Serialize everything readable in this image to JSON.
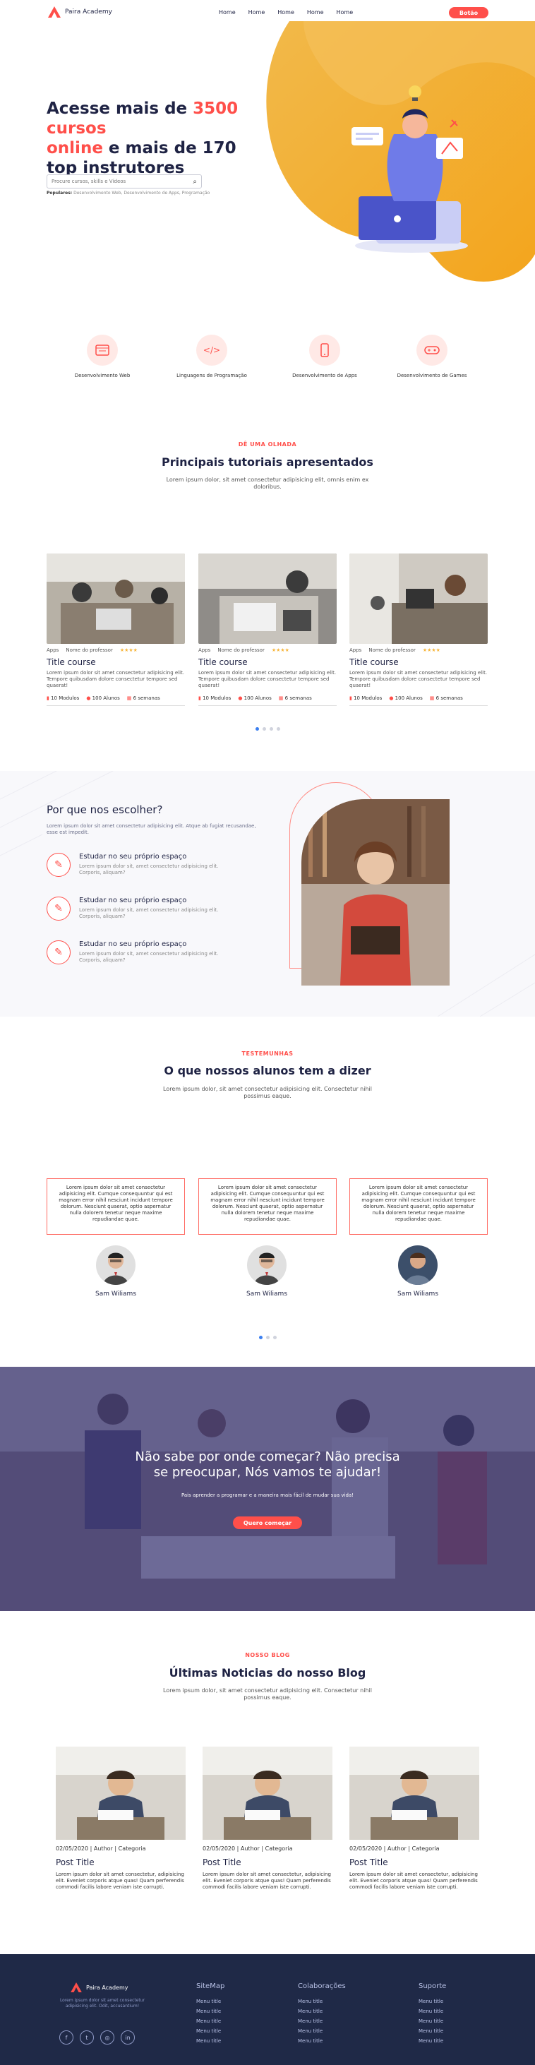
{
  "header": {
    "brand": "Paira Academy",
    "nav": [
      "Home",
      "Home",
      "Home",
      "Home",
      "Home"
    ],
    "cta": "Botão"
  },
  "hero": {
    "title_a": "Acesse mais de ",
    "title_b": "3500 cursos",
    "title_c": "online",
    "title_d": " e mais de 170",
    "title_e": "top instrutores",
    "search_placeholder": "Procure cursos, skills e Vídeos",
    "popular_label": "Populares:",
    "popular_items": "Desenvolvimento Web, Desenvolvimento de Apps, Programação"
  },
  "categories": [
    {
      "label": "Desenvolvimento Web",
      "icon": "web-icon"
    },
    {
      "label": "Linguagens de Programação",
      "icon": "code-icon"
    },
    {
      "label": "Desenvolvimento de Apps",
      "icon": "mobile-icon"
    },
    {
      "label": "Desenvolvimento de Games",
      "icon": "gamepad-icon"
    }
  ],
  "tutorials": {
    "kicker": "DÊ UMA OLHADA",
    "title": "Principais tutoriais apresentados",
    "subtitle": "Lorem ipsum dolor, sit amet consectetur adipisicing elit, omnis enim ex doloribus.",
    "cards": [
      {
        "cat": "Apps",
        "teacher": "Nome do professor",
        "stars": "★★★★",
        "title": "Title course",
        "text": "Lorem ipsum dolor sit amet consectetur adipisicing elit. Tempore quibusdam dolore consectetur tempore sed quaerat!",
        "modules": "10 Modulos",
        "students": "100 Alunos",
        "weeks": "6 semanas"
      },
      {
        "cat": "Apps",
        "teacher": "Nome do professor",
        "stars": "★★★★",
        "title": "Title course",
        "text": "Lorem ipsum dolor sit amet consectetur adipisicing elit. Tempore quibusdam dolore consectetur tempore sed quaerat!",
        "modules": "10 Modulos",
        "students": "100 Alunos",
        "weeks": "6 semanas"
      },
      {
        "cat": "Apps",
        "teacher": "Nome do professor",
        "stars": "★★★★",
        "title": "Title course",
        "text": "Lorem ipsum dolor sit amet consectetur adipisicing elit. Tempore quibusdam dolore consectetur tempore sed quaerat!",
        "modules": "10 Modulos",
        "students": "100 Alunos",
        "weeks": "6 semanas"
      }
    ]
  },
  "why": {
    "title": "Por que nos escolher?",
    "subtitle": "Lorem ipsum dolor sit amet consectetur adipisicing elit. Atque ab fugiat recusandae, esse est impedit.",
    "items": [
      {
        "title": "Estudar no seu próprio espaço",
        "text": "Lorem ipsum dolor sit, amet consectetur adipisicing elit. Corporis, aliquam?"
      },
      {
        "title": "Estudar no seu próprio espaço",
        "text": "Lorem ipsum dolor sit, amet consectetur adipisicing elit. Corporis, aliquam?"
      },
      {
        "title": "Estudar no seu próprio espaço",
        "text": "Lorem ipsum dolor sit, amet consectetur adipisicing elit. Corporis, aliquam?"
      }
    ]
  },
  "testimonials": {
    "kicker": "TESTEMUNHAS",
    "title": "O que nossos alunos tem a dizer",
    "subtitle": "Lorem ipsum dolor, sit amet consectetur adipisicing elit. Consectetur nihil possimus eaque.",
    "items": [
      {
        "text": "Lorem ipsum dolor sit amet consectetur adipisicing elit. Cumque consequuntur qui est magnam error nihil nesciunt incidunt tempore dolorum. Nesciunt quaerat, optio aspernatur nulla dolorem tenetur neque maxime repudiandae quae.",
        "name": "Sam Wiliams"
      },
      {
        "text": "Lorem ipsum dolor sit amet consectetur adipisicing elit. Cumque consequuntur qui est magnam error nihil nesciunt incidunt tempore dolorum. Nesciunt quaerat, optio aspernatur nulla dolorem tenetur neque maxime repudiandae quae.",
        "name": "Sam Wiliams"
      },
      {
        "text": "Lorem ipsum dolor sit amet consectetur adipisicing elit. Cumque consequuntur qui est magnam error nihil nesciunt incidunt tempore dolorum. Nesciunt quaerat, optio aspernatur nulla dolorem tenetur neque maxime repudiandae quae.",
        "name": "Sam Wiliams"
      }
    ]
  },
  "banner": {
    "title_1": "Não sabe por onde começar? Não precisa",
    "title_2": "se preocupar, Nós vamos te ajudar!",
    "subtitle": "Pais aprender a programar e a maneira mais fácil de mudar sua vida!",
    "cta": "Quero começar"
  },
  "blog": {
    "kicker": "NOSSO BLOG",
    "title": "Últimas Noticias do nosso Blog",
    "subtitle": "Lorem ipsum dolor, sit amet consectetur adipisicing elit. Consectetur nihil possimus eaque.",
    "posts": [
      {
        "date": "02/05/2020 | Author | Categoria",
        "title": "Post Title",
        "text": "Lorem ipsum dolor sit amet consectetur, adipisicing elit. Eveniet corporis atque quas! Quam perferendis commodi facilis labore veniam iste corrupti."
      },
      {
        "date": "02/05/2020 | Author | Categoria",
        "title": "Post Title",
        "text": "Lorem ipsum dolor sit amet consectetur, adipisicing elit. Eveniet corporis atque quas! Quam perferendis commodi facilis labore veniam iste corrupti."
      },
      {
        "date": "02/05/2020 | Author | Categoria",
        "title": "Post Title",
        "text": "Lorem ipsum dolor sit amet consectetur, adipisicing elit. Eveniet corporis atque quas! Quam perferendis commodi facilis labore veniam iste corrupti."
      }
    ]
  },
  "footer": {
    "brand": "Paira Academy",
    "about": "Lorem ipsum dolor sit amet consectetur adipisicing elit. Odit, accusantium!",
    "socials": [
      "f",
      "t",
      "◎",
      "in"
    ],
    "columns": [
      {
        "title": "SiteMap",
        "items": [
          "Menu title",
          "Menu title",
          "Menu title",
          "Menu title",
          "Menu title"
        ]
      },
      {
        "title": "Colaborações",
        "items": [
          "Menu title",
          "Menu title",
          "Menu title",
          "Menu title",
          "Menu title"
        ]
      },
      {
        "title": "Suporte",
        "items": [
          "Menu title",
          "Menu title",
          "Menu title",
          "Menu title",
          "Menu title"
        ]
      }
    ]
  },
  "colors": {
    "accent": "#ff4f4a",
    "navy": "#1f2344",
    "footer": "#1f2947",
    "hero_yellow": "#f4b840"
  }
}
